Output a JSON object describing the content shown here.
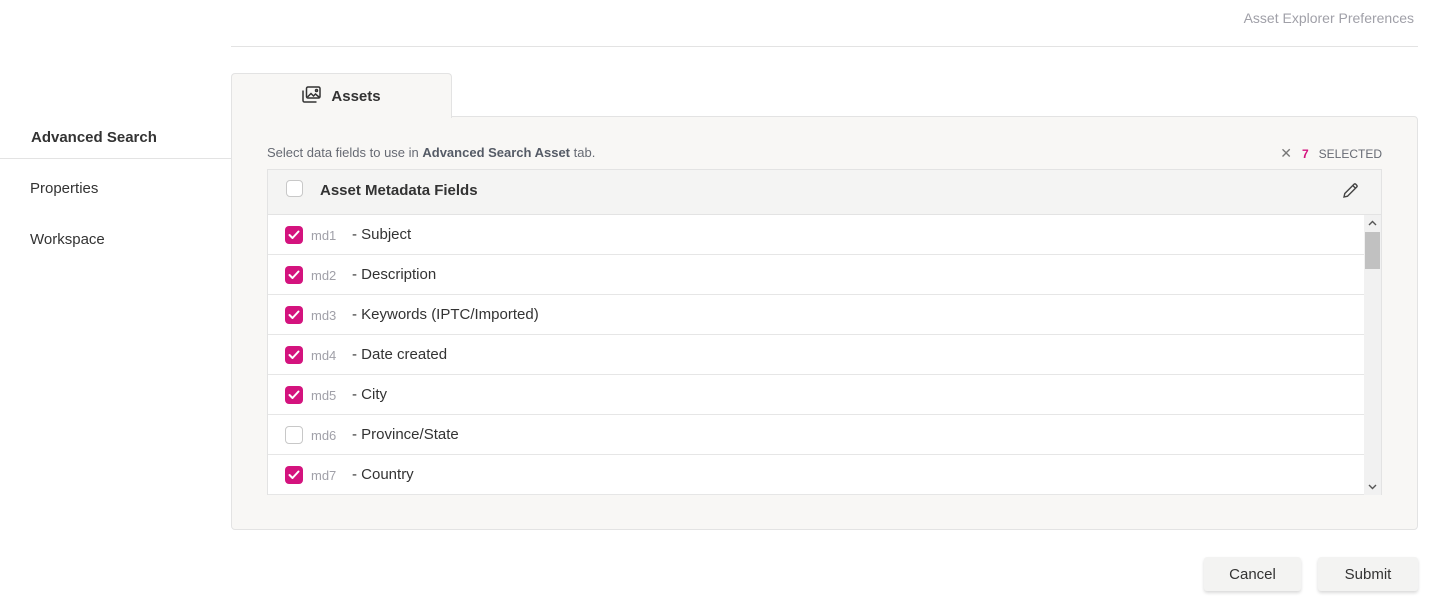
{
  "header": {
    "title": "Asset Explorer Preferences"
  },
  "sidebar": {
    "items": [
      {
        "label": "Advanced Search",
        "active": true
      },
      {
        "label": "Properties",
        "active": false
      },
      {
        "label": "Workspace",
        "active": false
      }
    ]
  },
  "tab": {
    "label": "Assets",
    "icon": "gallery-icon"
  },
  "panel": {
    "instruction_prefix": "Select data fields to use in ",
    "instruction_bold": "Advanced Search Asset",
    "instruction_suffix": " tab.",
    "selected_count": "7",
    "selected_label": "SELECTED",
    "clear_icon": "close-icon"
  },
  "table": {
    "header_label": "Asset Metadata Fields",
    "edit_icon": "pencil-icon",
    "rows": [
      {
        "code": "md1",
        "label": "- Subject",
        "checked": true
      },
      {
        "code": "md2",
        "label": "- Description",
        "checked": true
      },
      {
        "code": "md3",
        "label": "- Keywords (IPTC/Imported)",
        "checked": true
      },
      {
        "code": "md4",
        "label": "- Date created",
        "checked": true
      },
      {
        "code": "md5",
        "label": "- City",
        "checked": true
      },
      {
        "code": "md6",
        "label": "- Province/State",
        "checked": false
      },
      {
        "code": "md7",
        "label": "- Country",
        "checked": true
      }
    ]
  },
  "actions": {
    "cancel_label": "Cancel",
    "submit_label": "Submit"
  },
  "colors": {
    "accent": "#d4137e",
    "panel_bg": "#f8f7f5",
    "border": "#e3e3e3"
  }
}
